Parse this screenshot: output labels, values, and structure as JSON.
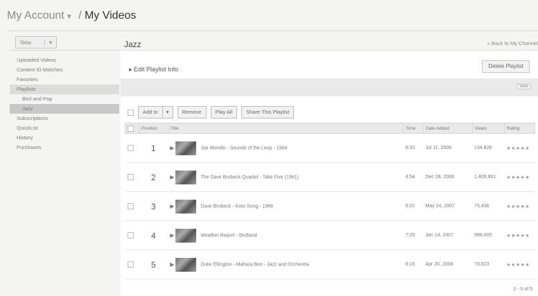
{
  "breadcrumb": {
    "account": "My Account",
    "separator": "/",
    "current": "My Videos"
  },
  "sidebar": {
    "new_button": "New",
    "items": [
      {
        "label": "Uploaded Videos"
      },
      {
        "label": "Content ID Matches"
      },
      {
        "label": "Favorites"
      },
      {
        "label": "Playlists",
        "selected": true
      },
      {
        "label": "Bird and Pop",
        "sub": true
      },
      {
        "label": "Jazz",
        "sub": true,
        "selected": true
      },
      {
        "label": "Subscriptions"
      },
      {
        "label": "QuickList"
      },
      {
        "label": "History"
      },
      {
        "label": "Purchases"
      }
    ]
  },
  "header": {
    "title": "Jazz",
    "back_link": "« Back to My Channel"
  },
  "playlist": {
    "edit_info": "Edit Playlist Info",
    "delete_button": "Delete Playlist",
    "view_control": "View"
  },
  "toolbar": {
    "add_to": "Add to",
    "remove": "Remove",
    "play_all": "Play All",
    "share": "Share This Playlist"
  },
  "table": {
    "columns": [
      "",
      "Position",
      "Title",
      "Time",
      "Date Added",
      "Views",
      "Rating"
    ],
    "rows": [
      {
        "position": "1",
        "title": "Joe Morello - Sounds of the Loop - 1964",
        "time": "8:33",
        "date": "Jul 11, 2006",
        "views": "134,826",
        "rating": "★★★★★"
      },
      {
        "position": "2",
        "title": "The Dave Brubeck Quartet - Take Five (1961)",
        "time": "4:54",
        "date": "Dec 28, 2006",
        "views": "1,409,661",
        "rating": "★★★★★"
      },
      {
        "position": "3",
        "title": "Dave Brubeck - Koto Song - 1966",
        "time": "8:02",
        "date": "May 24, 2007",
        "views": "75,436",
        "rating": "★★★★★"
      },
      {
        "position": "4",
        "title": "Weather Report - Birdland",
        "time": "7:25",
        "date": "Jan 14, 2007",
        "views": "988,405",
        "rating": "★★★★★"
      },
      {
        "position": "5",
        "title": "Duke Ellington - Mahara Boo - Jazz and Orchestra",
        "time": "8:16",
        "date": "Apr 20, 2008",
        "views": "73,823",
        "rating": "★★★★★"
      }
    ]
  },
  "pager": "1 - 5 of 5"
}
